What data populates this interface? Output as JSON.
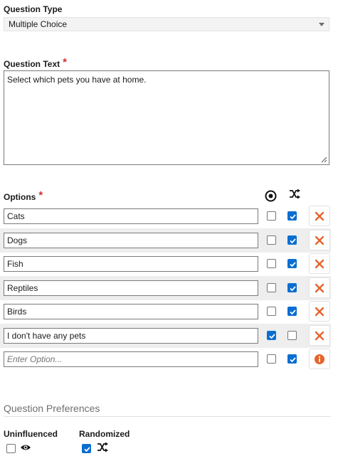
{
  "question_type": {
    "label": "Question Type",
    "selected": "Multiple Choice"
  },
  "question_text": {
    "label": "Question Text",
    "required_mark": "*",
    "value": "Select which pets you have at home."
  },
  "options": {
    "label": "Options",
    "required_mark": "*",
    "header_icons": [
      "single-select-icon",
      "shuffle-icon"
    ],
    "items": [
      {
        "text": "Cats",
        "exclusive": false,
        "randomize": true,
        "action": "remove"
      },
      {
        "text": "Dogs",
        "exclusive": false,
        "randomize": true,
        "action": "remove"
      },
      {
        "text": "Fish",
        "exclusive": false,
        "randomize": true,
        "action": "remove"
      },
      {
        "text": "Reptiles",
        "exclusive": false,
        "randomize": true,
        "action": "remove"
      },
      {
        "text": "Birds",
        "exclusive": false,
        "randomize": true,
        "action": "remove"
      },
      {
        "text": "I don't have any pets",
        "exclusive": true,
        "randomize": false,
        "action": "remove"
      }
    ],
    "new_option": {
      "placeholder": "Enter Option...",
      "exclusive": false,
      "randomize": true,
      "action": "info"
    }
  },
  "preferences": {
    "title": "Question Preferences",
    "uninfluenced": {
      "label": "Uninfluenced",
      "checked": false,
      "icon": "eye-icon"
    },
    "randomized": {
      "label": "Randomized",
      "checked": true,
      "icon": "shuffle-icon"
    }
  },
  "colors": {
    "accent": "#0a6ed1",
    "danger": "#e8622b",
    "required": "#d32f2f",
    "row_stripe": "#eeeeee"
  }
}
